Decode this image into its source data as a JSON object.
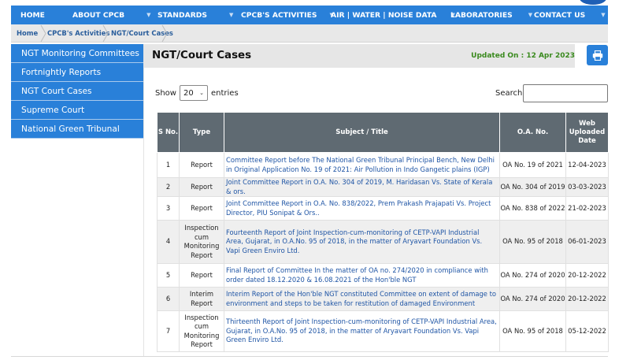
{
  "nav": [
    {
      "label": "HOME",
      "caret": false
    },
    {
      "label": "ABOUT CPCB",
      "caret": true
    },
    {
      "label": "STANDARDS",
      "caret": true
    },
    {
      "label": "CPCB'S ACTIVITIES",
      "caret": true
    },
    {
      "label": "AIR | WATER | NOISE DATA",
      "caret": true
    },
    {
      "label": "LABORATORIES",
      "caret": true
    },
    {
      "label": "CONTACT US",
      "caret": true
    }
  ],
  "breadcrumb": [
    "Home",
    "CPCB's Activities",
    "NGT/Court Cases"
  ],
  "sidebar": [
    "NGT Monitoring Committees",
    "Fortnightly Reports",
    "NGT Court Cases",
    "Supreme Court",
    "National Green Tribunal"
  ],
  "page": {
    "title": "NGT/Court Cases",
    "updated": "Updated On : 12 Apr 2023"
  },
  "table_controls": {
    "show_label": "Show",
    "entries_value": "20",
    "entries_label": "entries",
    "search_label": "Search:"
  },
  "table": {
    "headers": [
      "S No.",
      "Type",
      "Subject / Title",
      "O.A. No.",
      "Web Uploaded Date"
    ],
    "rows": [
      {
        "no": "1",
        "type": "Report",
        "subject": "Committee Report before The National Green Tribunal Principal Bench, New Delhi in Original Application No. 19 of 2021: Air Pollution in Indo Gangetic plains (IGP)",
        "oa": "OA No. 19 of 2021",
        "date": "12-04-2023"
      },
      {
        "no": "2",
        "type": "Report",
        "subject": "Joint Committee Report in O.A. No. 304 of 2019, M. Haridasan Vs. State of Kerala & ors.",
        "oa": "OA No. 304 of 2019",
        "date": "03-03-2023"
      },
      {
        "no": "3",
        "type": "Report",
        "subject": "Joint Committee Report in O.A. No. 838/2022, Prem Prakash Prajapati Vs. Project Director, PIU Sonipat & Ors..",
        "oa": "OA No. 838 of 2022",
        "date": "21-02-2023"
      },
      {
        "no": "4",
        "type": "Inspection cum Monitoring Report",
        "subject": "Fourteenth Report of Joint Inspection-cum-monitoring of CETP-VAPI Industrial Area, Gujarat, in O.A.No. 95 of 2018, in the matter of Aryavart Foundation Vs. Vapi Green Enviro Ltd.",
        "oa": "OA No. 95 of 2018",
        "date": "06-01-2023"
      },
      {
        "no": "5",
        "type": "Report",
        "subject": "Final Report of Committee In the matter of OA no. 274/2020 in compliance with order dated 18.12.2020 & 16.08.2021 of the Hon'ble NGT",
        "oa": "OA No. 274 of 2020",
        "date": "20-12-2022"
      },
      {
        "no": "6",
        "type": "Interim Report",
        "subject": "Interim Report of the Hon'ble NGT constituted Committee on extent of damage to environment and steps to be taken for restitution of damaged Environment",
        "oa": "OA No. 274 of 2020",
        "date": "20-12-2022"
      },
      {
        "no": "7",
        "type": "Inspection cum Monitoring Report",
        "subject": "Thirteenth Report of Joint Inspection-cum-monitoring of CETP-VAPI Industrial Area, Gujarat, in O.A.No. 95 of 2018, in the matter of Aryavart Foundation Vs. Vapi Green Enviro Ltd.",
        "oa": "OA No. 95 of 2018",
        "date": "05-12-2022"
      }
    ]
  }
}
